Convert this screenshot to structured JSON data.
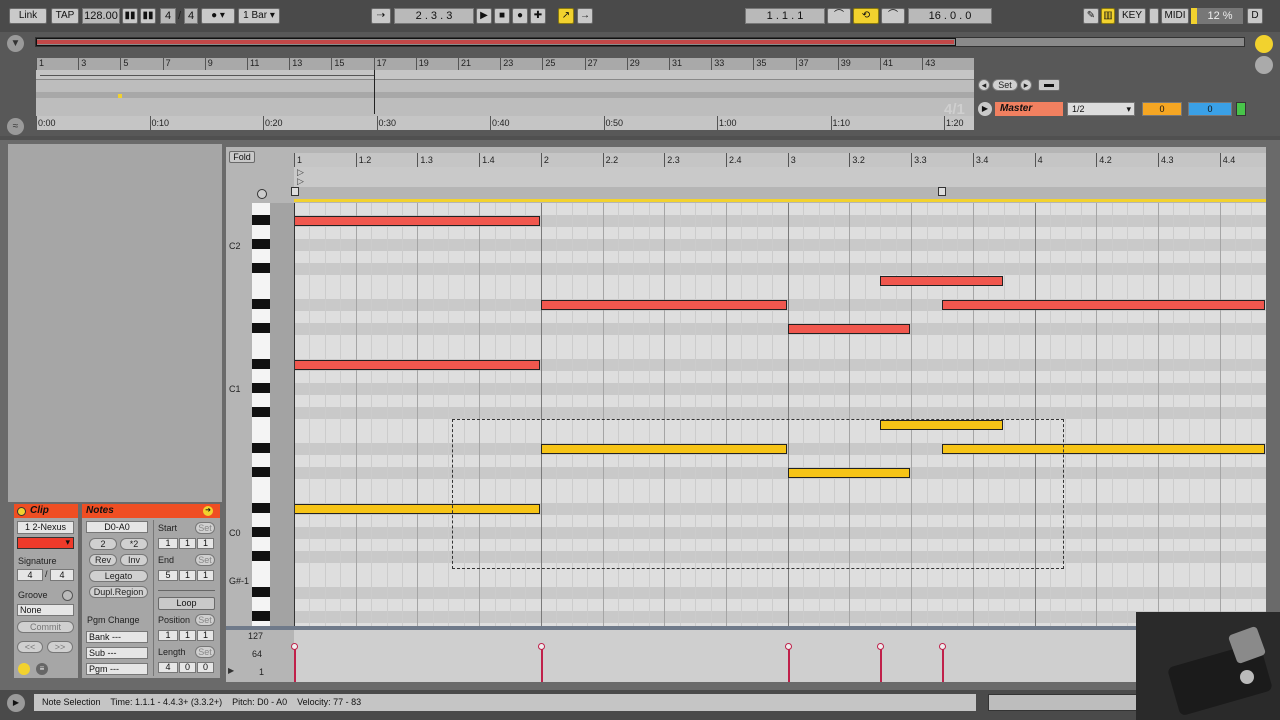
{
  "transport": {
    "link": "Link",
    "tap": "TAP",
    "tempo": "128.00",
    "sig_num": "4",
    "sig_den": "4",
    "metro": "●",
    "quant": "1 Bar",
    "arrow": "→",
    "position": "2 . 3 . 3",
    "loop_start": "1 . 1 . 1",
    "loop_length": "16 . 0 . 0",
    "key": "KEY",
    "midi": "MIDI",
    "cpu": "12 %",
    "d": "D"
  },
  "overview": {
    "bar_labels": [
      "1",
      "3",
      "5",
      "7",
      "9",
      "11",
      "13",
      "15",
      "17",
      "19",
      "21",
      "23",
      "25",
      "27",
      "29",
      "31",
      "33",
      "35",
      "37",
      "39",
      "41",
      "43"
    ],
    "time_labels": [
      "0:00",
      "0:10",
      "0:20",
      "0:30",
      "0:40",
      "0:50",
      "1:00",
      "1:10",
      "1:20"
    ],
    "set_label": "Set",
    "quant_display": "4/1",
    "master_label": "Master",
    "dropdown_value": "1/2",
    "orange_value": "0",
    "blue_value": "0"
  },
  "editor": {
    "fold": "Fold",
    "beat_labels": [
      "1",
      "1.2",
      "1.3",
      "1.4",
      "2",
      "2.2",
      "2.3",
      "2.4",
      "3",
      "3.2",
      "3.3",
      "3.4",
      "4",
      "4.2",
      "4.3",
      "4.4"
    ],
    "pitch_labels": [
      "C2",
      "C1",
      "C0",
      "G#-1"
    ],
    "vel_labels": [
      "127",
      "64",
      "1"
    ]
  },
  "clip_panel": {
    "title": "Clip",
    "name": "1 2-Nexus",
    "signature_label": "Signature",
    "sig_num": "4",
    "sig_den": "4",
    "groove_label": "Groove",
    "groove_value": "None",
    "commit": "Commit"
  },
  "notes_panel": {
    "title": "Notes",
    "range": "D0-A0",
    "half": "2",
    "double": "*2",
    "rev": "Rev",
    "inv": "Inv",
    "legato": "Legato",
    "dupl": "Dupl.Region",
    "pgm_change": "Pgm Change",
    "bank": "Bank ---",
    "sub": "Sub ---",
    "pgm": "Pgm ---",
    "start_label": "Start",
    "set": "Set",
    "start_vals": [
      "1",
      "1",
      "1"
    ],
    "end_label": "End",
    "end_vals": [
      "5",
      "1",
      "1"
    ],
    "loop": "Loop",
    "position_label": "Position",
    "position_vals": [
      "1",
      "1",
      "1"
    ],
    "length_label": "Length",
    "length_vals": [
      "4",
      "0",
      "0"
    ]
  },
  "status": {
    "text": "Note Selection    Time: 1.1.1 - 4.4.3+ (3.3.2+)    Pitch: D0 - A0    Velocity: 77 - 83"
  },
  "colors": {
    "accent": "#f2d22e",
    "clip_header": "#ef4e23",
    "note_red": "#f0574e",
    "note_gold": "#f6c417"
  }
}
